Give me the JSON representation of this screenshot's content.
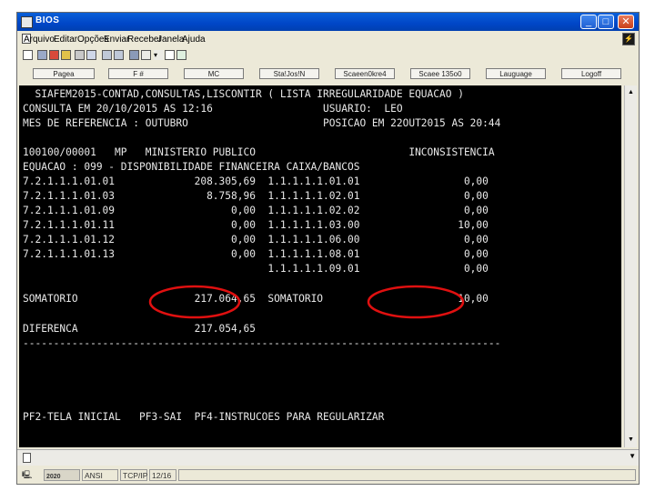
{
  "window": {
    "title": "BIOS"
  },
  "menu": [
    "Arquivo",
    "Editar",
    "Opções",
    "Enviar",
    "Receber",
    "Janela",
    "Ajuda"
  ],
  "toolbar_icons": [
    "page-setup-icon",
    "print-icon",
    "open-folder-icon",
    "folder-icon",
    "copy-icon",
    "paste-icon",
    "receive-file-icon",
    "send-file-icon",
    "settings-icon",
    "dropdown-arrow-icon",
    "checkbox-icon",
    "window-icon"
  ],
  "function_keys": [
    "Pagea",
    "F #",
    "MC",
    "Sta!Jos!N",
    "Scaeen0kre4",
    "Scaee 135o0",
    "Lauguage",
    "Logoff"
  ],
  "terminal": {
    "lines": [
      "  SIAFEM2015-CONTAD,CONSULTAS,LISCONTIR ( LISTA IRREGULARIDADE EQUACAO )",
      "CONSULTA EM 20/10/2015 AS 12:16                  USUARIO:  LEO",
      "MES DE REFERENCIA : OUTUBRO                      POSICAO EM 22OUT2015 AS 20:44",
      "",
      "100100/00001   MP   MINISTERIO PUBLICO                         INCONSISTENCIA",
      "EQUACAO : 099 - DISPONIBILIDADE FINANCEIRA CAIXA/BANCOS",
      "7.2.1.1.1.01.01             208.305,69  1.1.1.1.1.01.01                 0,00",
      "7.2.1.1.1.01.03               8.758,96  1.1.1.1.1.02.01                 0,00",
      "7.2.1.1.1.01.09                   0,00  1.1.1.1.1.02.02                 0,00",
      "7.2.1.1.1.01.11                   0,00  1.1.1.1.1.03.00                10,00",
      "7.2.1.1.1.01.12                   0,00  1.1.1.1.1.06.00                 0,00",
      "7.2.1.1.1.01.13                   0,00  1.1.1.1.1.08.01                 0,00",
      "                                        1.1.1.1.1.09.01                 0,00",
      "",
      "SOMATORIO                   217.064,65  SOMATORIO                      10,00",
      "",
      "DIFERENCA                   217.054,65",
      "------------------------------------------------------------------------------",
      "",
      "",
      "",
      "",
      "PF2-TELA INICIAL   PF3-SAI  PF4-INSTRUCOES PARA REGULARIZAR"
    ]
  },
  "status_bar": {
    "year": "2020",
    "encoding": "ANSI",
    "protocol": "TCP/IP",
    "cursor": "12/16"
  },
  "annotation_color": "#e01010"
}
